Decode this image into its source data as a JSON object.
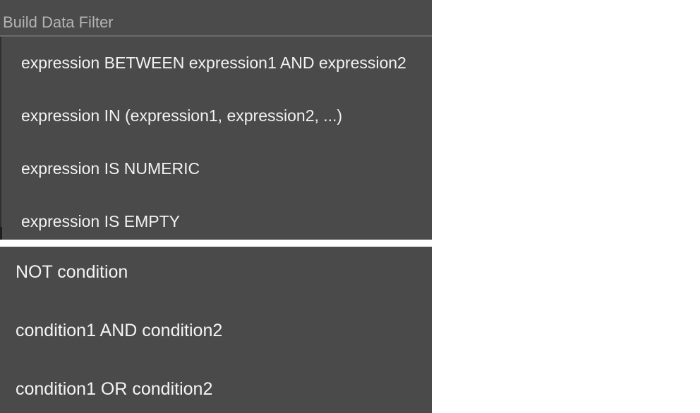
{
  "filter_panel": {
    "title": "Build Data Filter",
    "items": [
      {
        "label": "expression BETWEEN expression1 AND expression2"
      },
      {
        "label": "expression IN (expression1, expression2, ...)"
      },
      {
        "label": "expression IS NUMERIC"
      },
      {
        "label": "expression IS EMPTY"
      }
    ]
  },
  "condition_panel": {
    "items": [
      {
        "label": "NOT condition"
      },
      {
        "label": "condition1 AND condition2"
      },
      {
        "label": "condition1 OR condition2"
      }
    ]
  },
  "colors": {
    "panel_background": "#4a4a4a",
    "title_text": "#b4b4b4",
    "item_text": "#f2f2f2",
    "divider": "#6a6a6a",
    "page_background": "#ffffff"
  }
}
